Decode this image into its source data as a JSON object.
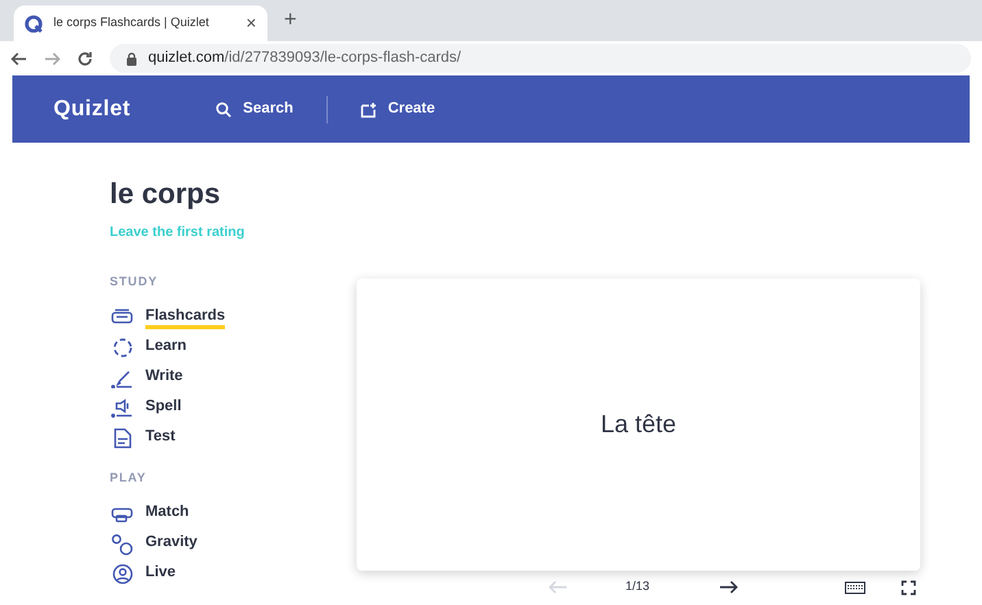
{
  "browser": {
    "tab_title": "le corps Flashcards | Quizlet",
    "close": "×",
    "new_tab": "+",
    "url_host": "quizlet.com",
    "url_path": "/id/277839093/le-corps-flash-cards/"
  },
  "header": {
    "logo": "Quizlet",
    "nav": [
      {
        "kind": "search",
        "label": "Search"
      },
      {
        "kind": "create",
        "label": "Create"
      }
    ]
  },
  "set": {
    "title": "le corps",
    "rating_link": "Leave the first rating"
  },
  "sections": [
    {
      "heading": "STUDY",
      "items": [
        {
          "kind": "flashcards",
          "label": "Flashcards",
          "selected": true
        },
        {
          "kind": "learn",
          "label": "Learn",
          "selected": false
        },
        {
          "kind": "write",
          "label": "Write",
          "selected": false
        },
        {
          "kind": "spell",
          "label": "Spell",
          "selected": false
        },
        {
          "kind": "test",
          "label": "Test",
          "selected": false
        }
      ]
    },
    {
      "heading": "PLAY",
      "items": [
        {
          "kind": "match",
          "label": "Match",
          "selected": false
        },
        {
          "kind": "gravity",
          "label": "Gravity",
          "selected": false
        },
        {
          "kind": "live",
          "label": "Live",
          "selected": false
        }
      ]
    }
  ],
  "card": {
    "term": "La tête"
  },
  "controls": {
    "prev_disabled": true,
    "next_disabled": false,
    "counter": "1/13"
  }
}
